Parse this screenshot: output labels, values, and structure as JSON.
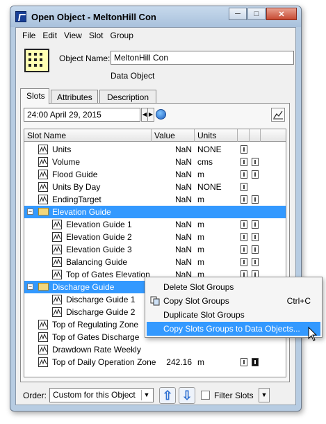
{
  "window": {
    "title": "Open Object - MeltonHill Con",
    "controls": [
      "minimize-icon",
      "maximize-icon",
      "close-icon"
    ]
  },
  "menu": [
    "File",
    "Edit",
    "View",
    "Slot",
    "Group"
  ],
  "object": {
    "name_label": "Object Name:",
    "name_value": "MeltonHill Con",
    "type": "Data Object"
  },
  "tabs": [
    "Slots",
    "Attributes",
    "Description"
  ],
  "datetime": "24:00 April 29, 2015",
  "table": {
    "headers": [
      "Slot Name",
      "Value",
      "Units"
    ],
    "rows": [
      {
        "name": "Units",
        "value": "NaN",
        "units": "NONE",
        "flags": 1
      },
      {
        "name": "Volume",
        "value": "NaN",
        "units": "cms",
        "flags": 2
      },
      {
        "name": "Flood Guide",
        "value": "NaN",
        "units": "m",
        "flags": 2
      },
      {
        "name": "Units By Day",
        "value": "NaN",
        "units": "NONE",
        "flags": 1
      },
      {
        "name": "EndingTarget",
        "value": "NaN",
        "units": "m",
        "flags": 2
      },
      {
        "group": "Elevation Guide"
      },
      {
        "name": "Elevation Guide 1",
        "value": "NaN",
        "units": "m",
        "flags": 2,
        "indent": 1
      },
      {
        "name": "Elevation Guide 2",
        "value": "NaN",
        "units": "m",
        "flags": 2,
        "indent": 1
      },
      {
        "name": "Elevation Guide 3",
        "value": "NaN",
        "units": "m",
        "flags": 2,
        "indent": 1
      },
      {
        "name": "Balancing Guide",
        "value": "NaN",
        "units": "m",
        "flags": 2,
        "indent": 1
      },
      {
        "name": "Top of Gates Elevation",
        "value": "NaN",
        "units": "m",
        "flags": 2,
        "indent": 1
      },
      {
        "group": "Discharge Guide"
      },
      {
        "name": "Discharge Guide 1",
        "indent": 1
      },
      {
        "name": "Discharge Guide 2",
        "indent": 1
      },
      {
        "name": "Top of Regulating Zone"
      },
      {
        "name": "Top of Gates Discharge"
      },
      {
        "name": "Drawdown Rate Weekly"
      },
      {
        "name": "Top of Daily Operation Zone",
        "value": "242.16",
        "units": "m",
        "flags": 2,
        "bold": true
      }
    ]
  },
  "context_menu": {
    "items": [
      {
        "label": "Delete Slot Groups",
        "shortcut": ""
      },
      {
        "label": "Copy Slot Groups",
        "shortcut": "Ctrl+C",
        "icon": "copy-icon"
      },
      {
        "label": "Duplicate Slot Groups",
        "shortcut": ""
      },
      {
        "label": "Copy Slots Groups to Data Objects...",
        "shortcut": "",
        "highlighted": true
      }
    ]
  },
  "footer": {
    "order_label": "Order:",
    "order_value": "Custom for this Object",
    "filter_label": "Filter Slots"
  },
  "colors": {
    "selection": "#3399ff",
    "titlebar": "#b7cce2",
    "object_icon": "#ffffb2"
  }
}
